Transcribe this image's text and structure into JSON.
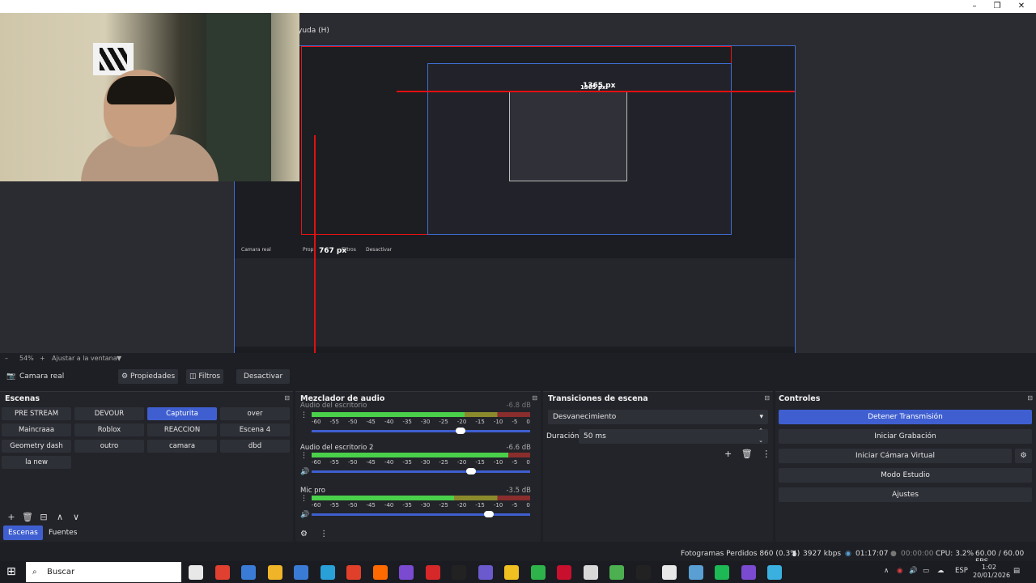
{
  "menu": {
    "help_label": "yuda (H)"
  },
  "window_controls": {
    "minimize": "–",
    "maximize": "❐",
    "close": "✕"
  },
  "preview": {
    "measure_h": "1365 px",
    "measure_v": "767 px",
    "nested_measure_h": "1365 px",
    "nested_labels": {
      "propiedades": "Propi",
      "filtros": "Filtros",
      "desactivar": "Desactivar",
      "camara": "Camara real"
    }
  },
  "zoom": {
    "minus": "–",
    "value": "54%",
    "plus": "+",
    "fit_label": "Ajustar a la ventana",
    "dropdown": "▼"
  },
  "source_toolbar": {
    "source_name": "Camara real",
    "properties": "Propiedades",
    "filters": "Filtros",
    "deactivate": "Desactivar"
  },
  "scenes": {
    "title": "Escenas",
    "undock": "⊟",
    "items": [
      "PRE STREAM",
      "DEVOUR",
      "Capturita",
      "over",
      "Maincraaa",
      "Roblox",
      "REACCION",
      "Escena 4",
      "Geometry dash",
      "outro",
      "camara",
      "dbd",
      "la new"
    ],
    "active": "Capturita",
    "tools": [
      "+",
      "🗑",
      "⊟",
      "∧",
      "∨"
    ],
    "tabs": [
      "Escenas",
      "Fuentes"
    ]
  },
  "mixer": {
    "title": "Mezclador de audio",
    "undock": "⊟",
    "scale": [
      "-60",
      "-55",
      "-50",
      "-45",
      "-40",
      "-35",
      "-30",
      "-25",
      "-20",
      "-15",
      "-10",
      "-5",
      "0"
    ],
    "channels": [
      {
        "name": "Audio del escritorio",
        "db": "-6.8 dB",
        "level": 0.7,
        "volume": 0.68
      },
      {
        "name": "Audio del escritorio 2",
        "db": "-6.6 dB",
        "level": 0.9,
        "volume": 0.73
      },
      {
        "name": "Mic pro",
        "db": "-3.5 dB",
        "level": 0.65,
        "volume": 0.81
      }
    ],
    "tools": [
      "⚙",
      "⋮"
    ]
  },
  "transitions": {
    "title": "Transiciones de escena",
    "undock": "⊟",
    "selected": "Desvanecimiento",
    "duration_label": "Duración",
    "duration_value": "50 ms",
    "tools": [
      "+",
      "🗑",
      "⋮"
    ]
  },
  "controls": {
    "title": "Controles",
    "undock": "⊟",
    "buttons": [
      "Detener Transmisión",
      "Iniciar Grabación",
      "Iniciar Cámara Virtual",
      "Modo Estudio",
      "Ajustes"
    ],
    "active": "Detener Transmisión"
  },
  "status": {
    "dropped": "Fotogramas Perdidos 860 (0.3%)",
    "bitrate": "3927 kbps",
    "stream_time": "01:17:07",
    "rec_time": "00:00:00",
    "cpu": "CPU: 3.2%",
    "fps": "60.00 / 60.00 FPS"
  },
  "taskbar": {
    "search_placeholder": "Buscar",
    "lang": "ESP",
    "time": "1:02",
    "date": "20/01/2026",
    "colors": [
      "#e8e8e8",
      "#e04030",
      "#3a7bd5",
      "#f0b429",
      "#3a7bd5",
      "#2aa0d8",
      "#e0402a",
      "#ff6a00",
      "#7a4ad0",
      "#d62828",
      "#222222",
      "#6a5acd",
      "#f0c020",
      "#2db34a",
      "#c8102e",
      "#d8d8d8",
      "#4caf50",
      "#222222",
      "#e8e8e8",
      "#5a9fd4",
      "#1db954",
      "#7a4ad0",
      "#3ab0e0"
    ]
  }
}
